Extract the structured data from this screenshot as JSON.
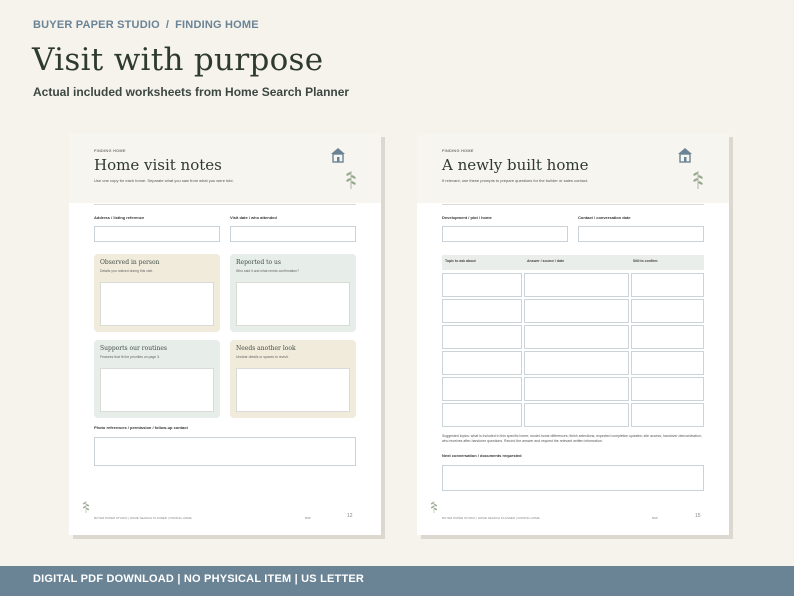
{
  "header": {
    "brand": "BUYER PAPER STUDIO",
    "separator": "/",
    "section": "FINDING HOME",
    "title": "Visit with purpose",
    "subtitle": "Actual included worksheets from Home Search Planner"
  },
  "left_sheet": {
    "eyebrow": "FINDING HOME",
    "title": "Home visit notes",
    "intro": "Use one copy for each home. Separate what you saw from what you were told.",
    "field_address": "Address / listing reference",
    "field_visit": "Visit date / who attended",
    "cards": [
      {
        "title": "Observed in person",
        "sub": "Details you noticed during this visit."
      },
      {
        "title": "Reported to us",
        "sub": "Who said it and what needs confirmation?"
      },
      {
        "title": "Supports our routines",
        "sub": "Features that fit the priorities on page 3."
      },
      {
        "title": "Needs another look",
        "sub": "Unclear details or spaces to revisit."
      }
    ],
    "field_photo": "Photo references / permission / follow-up contact",
    "footer": "BUYER PAPER STUDIO  |  HOME SEARCH PLANNER  |  FINDING HOME",
    "footer_mark": "BSP",
    "page": "12"
  },
  "right_sheet": {
    "eyebrow": "FINDING HOME",
    "title": "A newly built home",
    "intro": "If relevant, use these prompts to prepare questions for the builder or sales contact.",
    "field_dev": "Development / plot / home",
    "field_contact": "Contact / conversation date",
    "columns": [
      "Topic to ask about",
      "Answer / source / date",
      "Still to confirm"
    ],
    "note": "Suggested topics: what is included in this specific home; model-home differences; finish selections; expected completion updates; site access; handover demonstration; who receives after-handover questions. Record the answer and request the relevant written information.",
    "field_next": "Next conversation / documents requested",
    "footer": "BUYER PAPER STUDIO  |  HOME SEARCH PLANNER  |  FINDING HOME",
    "footer_mark": "BSP",
    "page": "15"
  },
  "bottom_bar": {
    "text": "DIGITAL PDF DOWNLOAD  |  NO PHYSICAL ITEM  |  US LETTER"
  },
  "colors": {
    "page_bg": "#f6f3ec",
    "accent_blue": "#6a8496",
    "heading_green": "#2e3a2f",
    "card_beige": "#f1ebdc",
    "card_sage": "#e7ede9"
  },
  "icons": [
    "house-icon",
    "leaf-sprig-icon"
  ]
}
